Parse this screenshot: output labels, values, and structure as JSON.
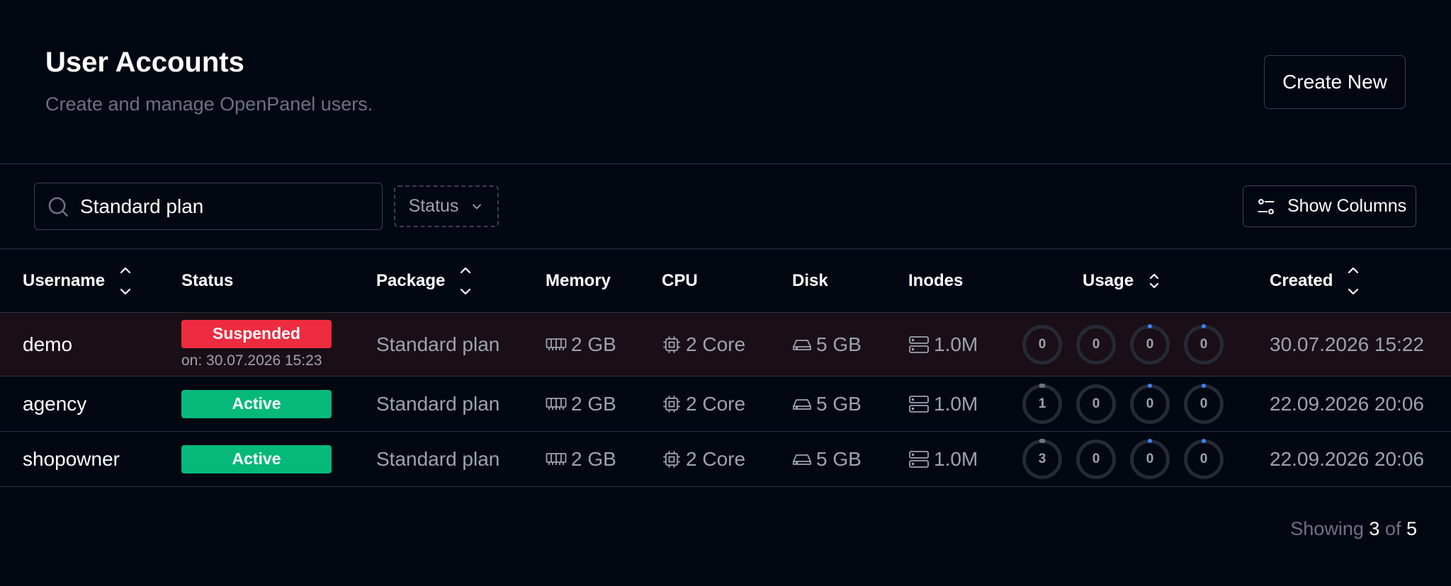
{
  "header": {
    "title": "User Accounts",
    "subtitle": "Create and manage OpenPanel users.",
    "create_button": "Create New"
  },
  "toolbar": {
    "search_value": "Standard plan",
    "status_filter_label": "Status",
    "show_columns_label": "Show Columns"
  },
  "columns": {
    "username": "Username",
    "status": "Status",
    "package": "Package",
    "memory": "Memory",
    "cpu": "CPU",
    "disk": "Disk",
    "inodes": "Inodes",
    "usage": "Usage",
    "created": "Created"
  },
  "rows": [
    {
      "username": "demo",
      "status": "Suspended",
      "status_color": "#ef2b3f",
      "suspended_note": "on: 30.07.2026 15:23",
      "package": "Standard plan",
      "memory": "2 GB",
      "cpu": "2 Core",
      "disk": "5 GB",
      "inodes": "1.0M",
      "usage": [
        "0",
        "0",
        "0",
        "0"
      ],
      "created": "30.07.2026 15:22"
    },
    {
      "username": "agency",
      "status": "Active",
      "status_color": "#05b97a",
      "package": "Standard plan",
      "memory": "2 GB",
      "cpu": "2 Core",
      "disk": "5 GB",
      "inodes": "1.0M",
      "usage": [
        "1",
        "0",
        "0",
        "0"
      ],
      "created": "22.09.2026 20:06"
    },
    {
      "username": "shopowner",
      "status": "Active",
      "status_color": "#05b97a",
      "package": "Standard plan",
      "memory": "2 GB",
      "cpu": "2 Core",
      "disk": "5 GB",
      "inodes": "1.0M",
      "usage": [
        "3",
        "0",
        "0",
        "0"
      ],
      "created": "22.09.2026 20:06"
    }
  ],
  "footer": {
    "showing_label": "Showing",
    "shown_count": "3",
    "of_label": "of",
    "total_count": "5"
  },
  "icons": {
    "search": "search-icon",
    "status_filter": "chevron-down-icon",
    "show_columns": "sliders-icon",
    "sort": "sort-icon",
    "memory": "memory-icon",
    "cpu": "cpu-icon",
    "disk": "hard-drive-icon",
    "inodes": "server-icon"
  }
}
